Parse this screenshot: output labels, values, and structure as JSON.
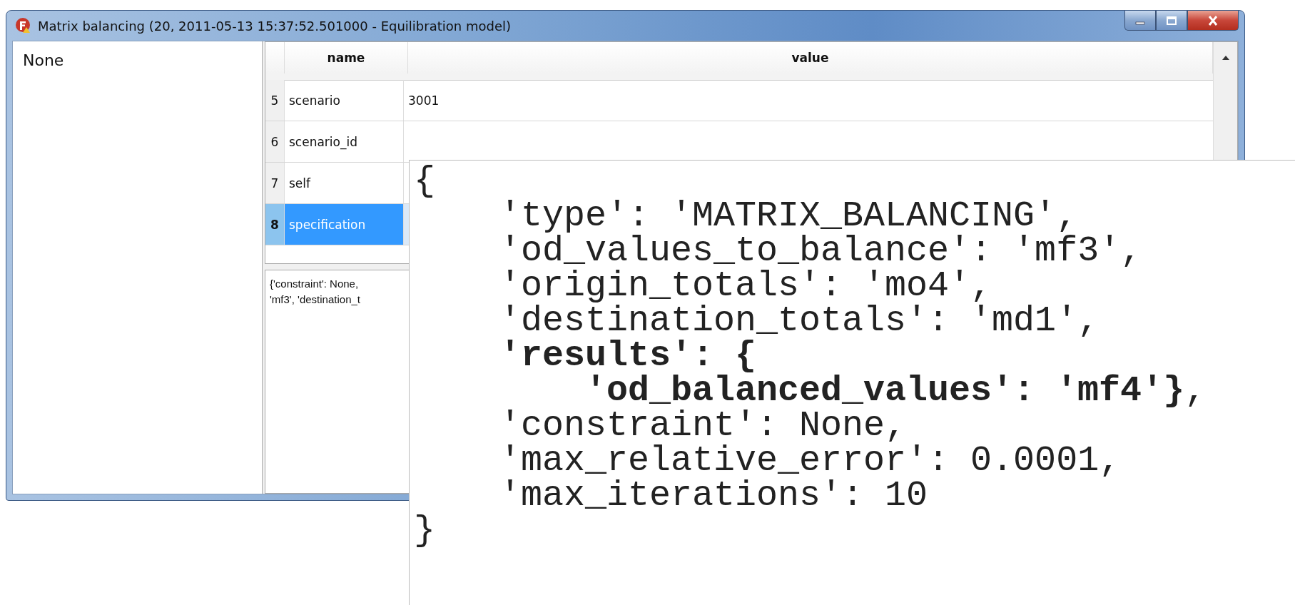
{
  "window": {
    "title": "Matrix balancing (20, 2011-05-13 15:37:52.501000 - Equilibration model)"
  },
  "left_pane": {
    "text": "None"
  },
  "table": {
    "columns": [
      "name",
      "value"
    ],
    "rows": [
      {
        "index": "5",
        "name": "scenario",
        "value": "3001",
        "selected": false
      },
      {
        "index": "6",
        "name": "scenario_id",
        "selected": false
      },
      {
        "index": "7",
        "name": "self",
        "selected": false
      },
      {
        "index": "8",
        "name": "specification",
        "selected": true
      }
    ]
  },
  "detail_text": "{'constraint': None,\n'mf3', 'destination_t",
  "callout": {
    "open": "{",
    "close": "}",
    "entries": [
      {
        "text": "'type': 'MATRIX_BALANCING',",
        "bold": false
      },
      {
        "text": "'od_values_to_balance': 'mf3',",
        "bold": false
      },
      {
        "text": "'origin_totals': 'mo4',",
        "bold": false
      },
      {
        "text": "'destination_totals': 'md1',",
        "bold": false
      },
      {
        "text": "'results': {",
        "bold": true,
        "children": [
          {
            "text": "**'od_balanced_values': 'mf4'}**,",
            "bold": false
          }
        ]
      },
      {
        "text": "'constraint': None,",
        "bold": false
      },
      {
        "text": "'max_relative_error': 0.0001,",
        "bold": false
      },
      {
        "text": "'max_iterations': 10",
        "bold": false
      }
    ]
  }
}
